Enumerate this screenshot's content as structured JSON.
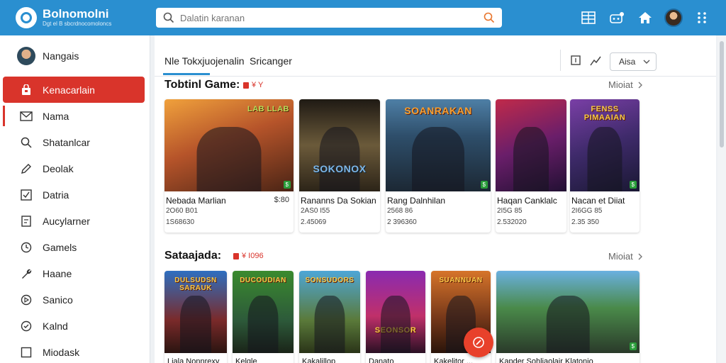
{
  "brand": {
    "title": "Bolnomolni",
    "subtitle": "Dgt el B sbcrdnocomoloncs"
  },
  "search": {
    "placeholder": "Dalatin karanan"
  },
  "topbar": {
    "icons": [
      "grid-list-icon",
      "controller-icon",
      "home-icon",
      "user-avatar",
      "apps-icon"
    ]
  },
  "user": {
    "name": "Nangais"
  },
  "sidebar": {
    "items": [
      {
        "label": "Kenacarlain",
        "icon": "bag-icon",
        "active": true
      },
      {
        "label": "Nama",
        "icon": "mail-icon"
      },
      {
        "label": "Shatanlcar",
        "icon": "search-icon"
      },
      {
        "label": "Deolak",
        "icon": "pencil-icon"
      },
      {
        "label": "Datria",
        "icon": "checkbox-icon"
      },
      {
        "label": "Aucylarner",
        "icon": "document-icon"
      },
      {
        "label": "Gamels",
        "icon": "clock-icon"
      },
      {
        "label": "Haane",
        "icon": "wrench-icon"
      },
      {
        "label": "Sanico",
        "icon": "play-circle-icon"
      },
      {
        "label": "Kalnd",
        "icon": "badge-check-icon"
      },
      {
        "label": "Miodask",
        "icon": "square-icon"
      }
    ]
  },
  "subhead": {
    "tab1": "Nle Tokxjuojenalin",
    "tab2": "Sricanger",
    "select": "Aisa"
  },
  "section1": {
    "title": "Tobtinl Game:",
    "tag": "¥ Y",
    "more": "Mioiat",
    "cards": [
      {
        "art_title": "LAB LLAB",
        "name": "Nebada Marlian",
        "price": "$:80",
        "meta1": "2O60 B01",
        "meta2": "1S68630"
      },
      {
        "art_title": "SOKONOX",
        "name": "Rananns Da Sokian",
        "price": "",
        "meta1": "2AS0 I55",
        "meta2": "2.45069"
      },
      {
        "art_title": "SOANRAKAN",
        "name": "Rang Dalnhilan",
        "price": "",
        "meta1": "2568 86",
        "meta2": "2 396360"
      },
      {
        "art_title": "",
        "name": "Haqan Canklalc",
        "price": "",
        "meta1": "2I5G 85",
        "meta2": "2.532020"
      },
      {
        "art_title": "FENSS PIMAAIAN",
        "name": "Nacan et Diiat",
        "price": "",
        "meta1": "2I6GG 85",
        "meta2": "2.35 350"
      }
    ]
  },
  "section2": {
    "title": "Sataajada:",
    "tag": "¥ I096",
    "more": "Mioiat",
    "cards": [
      {
        "art_title": "DULSUDSN SARAUK",
        "name": "Liala Nonnrexy"
      },
      {
        "art_title": "DUCOUDIAN",
        "name": "Kelqle"
      },
      {
        "art_title": "SONSUDORS",
        "name": "Kakalillop"
      },
      {
        "art_title": "SEONSOR",
        "name": "Danato"
      },
      {
        "art_title": "SUANNUAN",
        "name": "Kakelitor ..."
      },
      {
        "art_title": "",
        "name": "Kapder Sohliaolair Klatonio"
      }
    ]
  },
  "colors": {
    "topbar": "#2a8fd0",
    "accent": "#d9342b",
    "fab": "#e8412b"
  }
}
